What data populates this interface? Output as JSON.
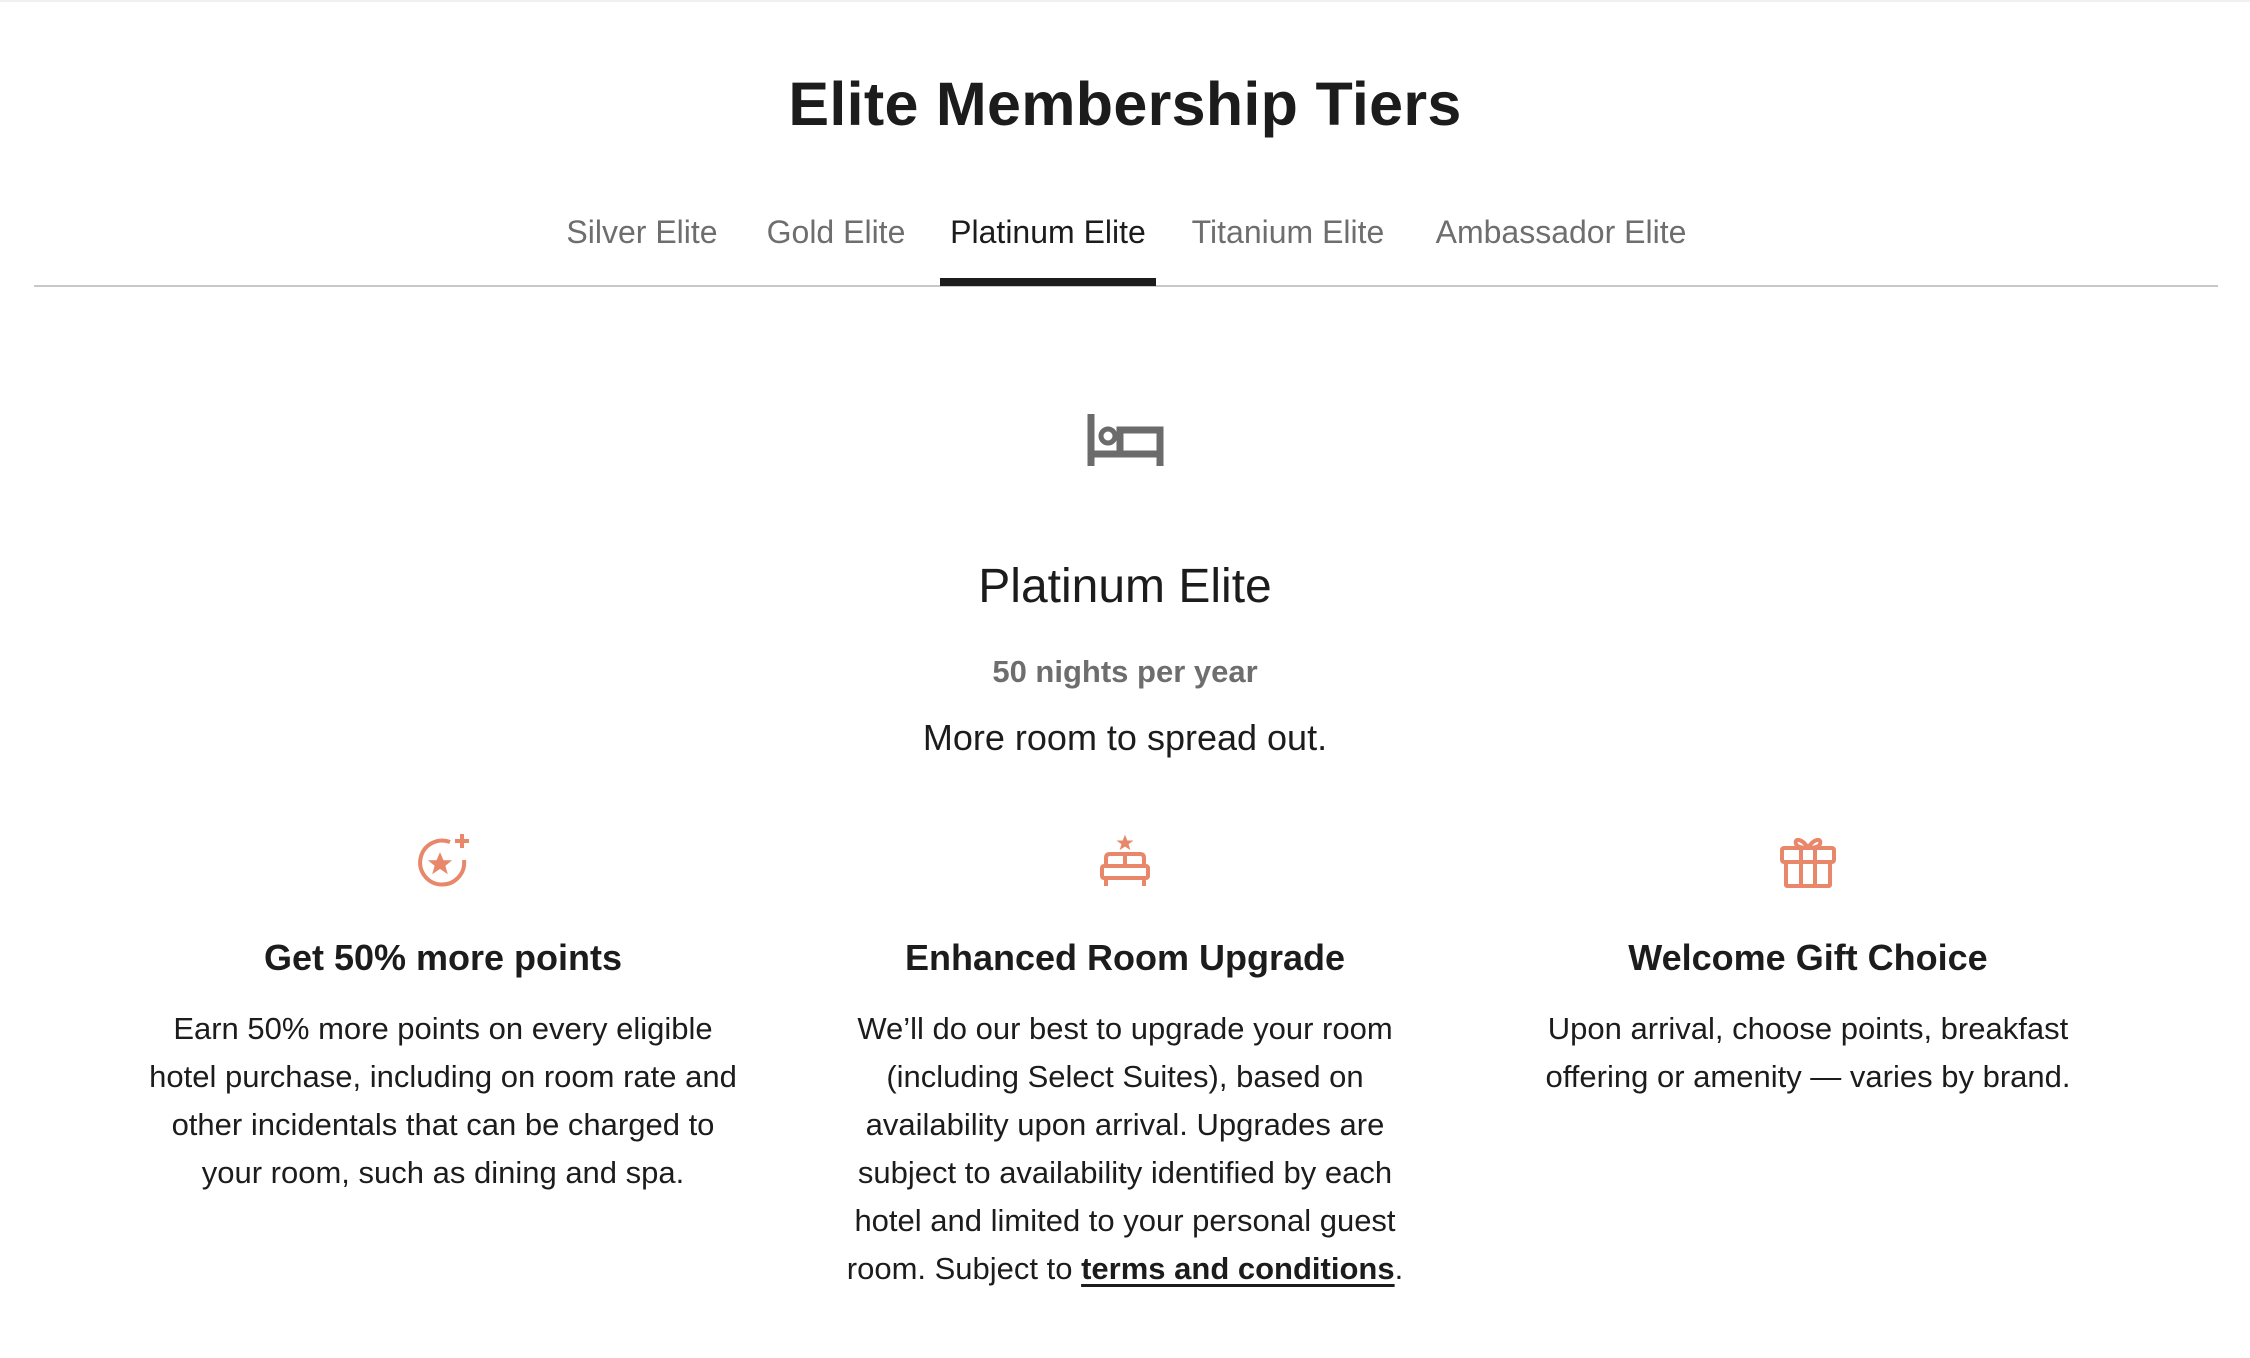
{
  "page": {
    "title": "Elite Membership Tiers"
  },
  "tabs": [
    {
      "label": "Silver Elite",
      "active": false
    },
    {
      "label": "Gold Elite",
      "active": false
    },
    {
      "label": "Platinum Elite",
      "active": true
    },
    {
      "label": "Titanium Elite",
      "active": false
    },
    {
      "label": "Ambassador Elite",
      "active": false
    }
  ],
  "tier": {
    "icon": "bed-icon",
    "name": "Platinum Elite",
    "requirement": "50 nights per year",
    "tagline": "More room to spread out."
  },
  "benefits": [
    {
      "icon": "star-plus-icon",
      "title": "Get 50% more points",
      "description": "Earn 50% more points on every eligible hotel purchase, including on room rate and other incidentals that can be charged to your room, such as dining and spa."
    },
    {
      "icon": "bed-star-icon",
      "title": "Enhanced Room Upgrade",
      "description": "We’ll do our best to upgrade your room (including Select Suites), based on availability upon arrival. Upgrades are subject to availability identified by each hotel and limited to your personal guest room. Subject to ",
      "link_text": "terms and conditions",
      "description_end": "."
    },
    {
      "icon": "gift-icon",
      "title": "Welcome Gift Choice",
      "description": "Upon arrival, choose points, breakfast offering or amenity — varies by brand."
    }
  ],
  "colors": {
    "accent": "#e8876a",
    "text": "#1c1c1c",
    "muted": "#6e6e6e",
    "divider": "#c8c8c8"
  }
}
